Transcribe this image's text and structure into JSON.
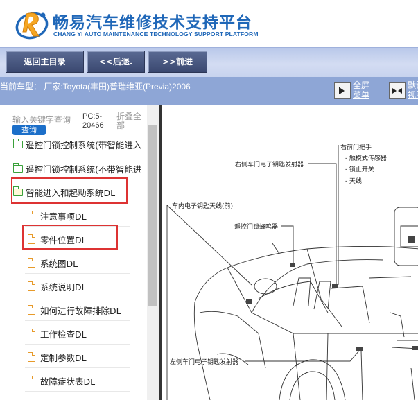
{
  "header": {
    "title": "畅易汽车维修技术支持平台",
    "subtitle": "CHANG YI AUTO MAINTENANCE TECHNOLOGY SUPPORT PLATFORM"
  },
  "toolbar": {
    "home_label": "返回主目录",
    "back_label": "<<后退.",
    "forward_label": ">>前进"
  },
  "infobar": {
    "car_type": "当前车型：  厂家:Toyota(丰田)普瑞维亚(Previa)2006",
    "fullscreen_line1": "全屏",
    "fullscreen_line2": "菜单",
    "default_line1": "默认",
    "default_line2": "视图"
  },
  "sidebar": {
    "search_placeholder": "输入关键字查询",
    "query_label": "查询",
    "pc_line1": "PC:5-",
    "pc_line2": "20466",
    "fold_line1": "折叠全",
    "fold_line2": "部",
    "items": [
      {
        "label": "遥控门锁控制系统(带智能进入"
      },
      {
        "label": "遥控门锁控制系统(不带智能进"
      },
      {
        "label": "智能进入和起动系统DL"
      },
      {
        "label": "注意事项DL"
      },
      {
        "label": "零件位置DL"
      },
      {
        "label": "系统图DL"
      },
      {
        "label": "系统说明DL"
      },
      {
        "label": "如何进行故障排除DL"
      },
      {
        "label": "工作检查DL"
      },
      {
        "label": "定制参数DL"
      },
      {
        "label": "故障症状表DL"
      }
    ]
  },
  "diagram": {
    "labels": {
      "right_handle": "右前门把手",
      "touch_sensor": "触模式传感器",
      "lock_switch": "锁止开关",
      "antenna": "天线",
      "right_oscillator": "右侧车门电子钥匙发射器",
      "interior_antenna": "车内电子钥匙天线(前)",
      "buzzer": "遥控门锁蜂鸣器",
      "left_oscillator": "左侧车门电子钥匙发射器"
    },
    "bullet": "-"
  },
  "colors": {
    "brand_blue": "#1f67b8",
    "toolbar_button": "#4a5880",
    "infobar": "#8ea6d6",
    "highlight_red": "#d33333",
    "folder_green": "#3aa13a",
    "doc_orange": "#e79a2a"
  }
}
